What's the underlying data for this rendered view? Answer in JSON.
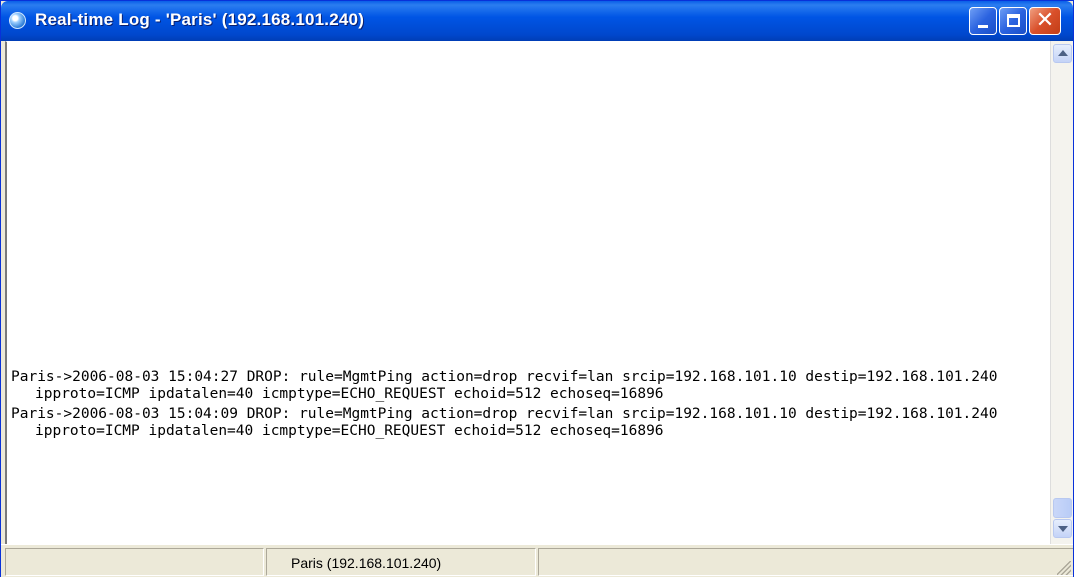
{
  "window": {
    "title": "Real-time Log - 'Paris' (192.168.101.240)",
    "title_icon": "realtime-log-app-icon",
    "controls": {
      "minimize_icon": "minimize-icon",
      "maximize_icon": "maximize-icon",
      "close_icon": "close-icon",
      "close_glyph": "✕"
    }
  },
  "log": {
    "entries": [
      "Paris->2006-08-03 15:04:27  DROP: rule=MgmtPing action=drop recvif=lan srcip=192.168.101.10 destip=192.168.101.240 ipproto=ICMP ipdatalen=40 icmptype=ECHO_REQUEST echoid=512 echoseq=16896",
      "Paris->2006-08-03 15:04:09  DROP: rule=MgmtPing action=drop recvif=lan srcip=192.168.101.10 destip=192.168.101.240 ipproto=ICMP ipdatalen=40 icmptype=ECHO_REQUEST echoid=512 echoseq=16896"
    ]
  },
  "statusbar": {
    "panel1": "",
    "panel2": "Paris (192.168.101.240)",
    "panel3": ""
  },
  "colors": {
    "titlebar": "#0055E5",
    "close_button": "#D9502B",
    "window_face": "#ECE9D8"
  }
}
